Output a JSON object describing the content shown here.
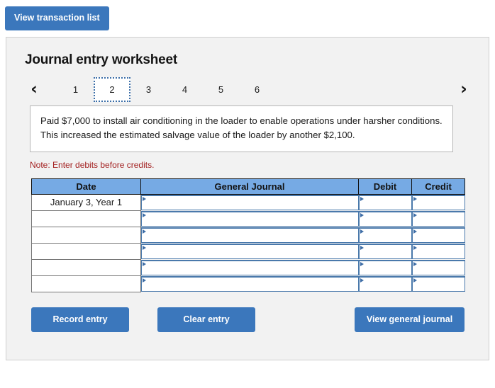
{
  "toolbar": {
    "view_transaction_list_label": "View transaction list"
  },
  "worksheet": {
    "title": "Journal entry worksheet",
    "pager": {
      "prev_icon": "‹",
      "next_icon": "›",
      "pages": [
        "1",
        "2",
        "3",
        "4",
        "5",
        "6"
      ],
      "active_page": "2"
    },
    "description": "Paid $7,000 to install air conditioning in the loader to enable operations under harsher conditions. This increased the estimated salvage value of the loader by another $2,100.",
    "note": "Note: Enter debits before credits.",
    "table": {
      "headers": [
        "Date",
        "General Journal",
        "Debit",
        "Credit"
      ],
      "rows": [
        {
          "date": "January 3, Year 1",
          "general_journal": "",
          "debit": "",
          "credit": ""
        },
        {
          "date": "",
          "general_journal": "",
          "debit": "",
          "credit": ""
        },
        {
          "date": "",
          "general_journal": "",
          "debit": "",
          "credit": ""
        },
        {
          "date": "",
          "general_journal": "",
          "debit": "",
          "credit": ""
        },
        {
          "date": "",
          "general_journal": "",
          "debit": "",
          "credit": ""
        },
        {
          "date": "",
          "general_journal": "",
          "debit": "",
          "credit": ""
        }
      ]
    },
    "actions": {
      "record_entry_label": "Record entry",
      "clear_entry_label": "Clear entry",
      "view_general_journal_label": "View general journal"
    }
  },
  "colors": {
    "button_blue": "#3b77bc",
    "header_blue": "#76aae4",
    "note_red": "#a32020",
    "panel_gray": "#f2f2f2",
    "field_border_blue": "#4a79ab"
  }
}
